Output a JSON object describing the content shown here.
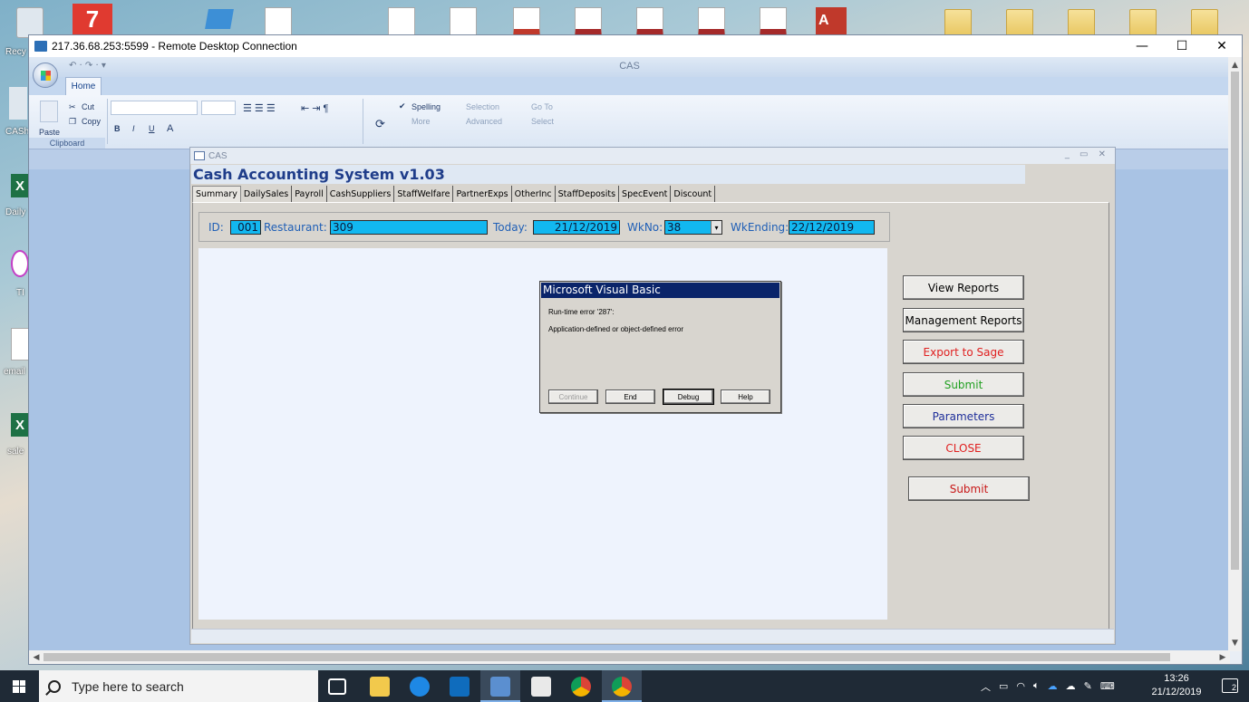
{
  "desktop": {
    "labels": [
      "Recy",
      "CASh",
      "Daily",
      "TI",
      "email",
      "sale"
    ]
  },
  "rdp": {
    "title": "217.36.68.253:5599 - Remote Desktop Connection",
    "minimize": "—",
    "maximize": "☐",
    "close": "✕"
  },
  "access": {
    "app_title": "CAS",
    "home_tab": "Home",
    "ribbon": {
      "cut": "Cut",
      "copy": "Copy",
      "paste": "Paste",
      "clipboard": "Clipboard",
      "spelling": "Spelling",
      "more": "More",
      "selection": "Selection",
      "advanced": "Advanced",
      "goto": "Go To",
      "select": "Select",
      "bold": "B",
      "italic": "I",
      "underline": "U",
      "font_color": "A"
    }
  },
  "form": {
    "window_title": "CAS",
    "window_ctrls": "_ ▭ ✕",
    "header": "Cash Accounting System v1.03",
    "tabs": [
      "Summary",
      "DailySales",
      "Payroll",
      "CashSuppliers",
      "StaffWelfare",
      "PartnerExps",
      "OtherInc",
      "StaffDeposits",
      "SpecEvent",
      "Discount"
    ],
    "active_tab": 0,
    "info": {
      "id_label": "ID:",
      "id_value": "001",
      "restaurant_label": "Restaurant:",
      "restaurant_value": "309",
      "today_label": "Today:",
      "today_value": "21/12/2019",
      "wkno_label": "WkNo:",
      "wkno_value": "38",
      "wkending_label": "WkEnding:",
      "wkending_value": "22/12/2019"
    },
    "buttons": {
      "view_reports": "View Reports",
      "management_reports": "Management Reports",
      "export_to_sage": "Export to Sage",
      "submit_1": "Submit",
      "parameters": "Parameters",
      "close": "CLOSE",
      "submit_2": "Submit"
    },
    "button_colors": {
      "view_reports": "#000000",
      "management_reports": "#000000",
      "export_to_sage": "#e02020",
      "submit_1": "#22a022",
      "parameters": "#1f2f9a",
      "close": "#e02020",
      "submit_2": "#c81818"
    }
  },
  "dialog": {
    "title": "Microsoft Visual Basic",
    "line1": "Run-time error '287':",
    "line2": "Application-defined or object-defined error",
    "btn_continue": "Continue",
    "btn_end": "End",
    "btn_debug": "Debug",
    "btn_help": "Help"
  },
  "taskbar": {
    "search_placeholder": "Type here to search",
    "time": "13:26",
    "date": "21/12/2019",
    "notifications": "2"
  }
}
